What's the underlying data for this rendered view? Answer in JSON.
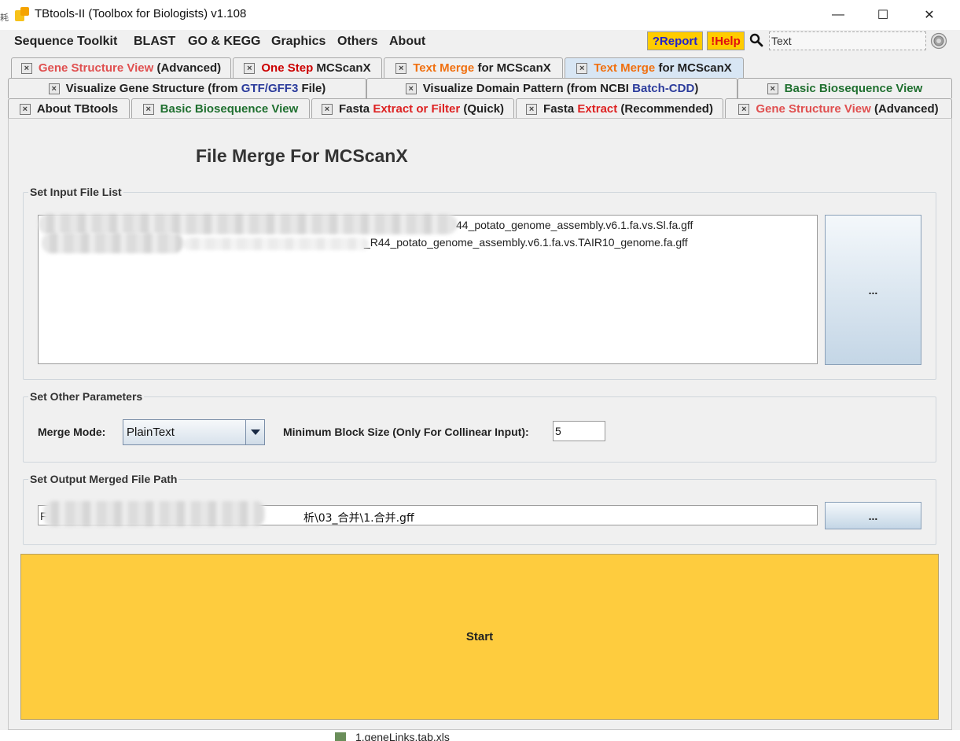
{
  "window": {
    "title": "TBtools-II (Toolbox for Biologists) v1.108",
    "minimize_glyph": "—",
    "maximize_glyph": "☐",
    "close_glyph": "✕",
    "edge_char": "耗"
  },
  "menu": {
    "items": [
      "Sequence Toolkit",
      "BLAST",
      "GO & KEGG",
      "Graphics",
      "Others",
      "About"
    ],
    "report_label": "?Report",
    "help_label": "!Help",
    "search_value": "Text"
  },
  "tabs": {
    "row1": [
      {
        "parts": [
          "Gene Structure View",
          " (Advanced)"
        ]
      },
      {
        "parts": [
          "One Step",
          " MCScanX"
        ]
      },
      {
        "parts": [
          "Text Merge",
          " for MCScanX"
        ]
      },
      {
        "parts": [
          "Text Merge",
          " for MCScanX"
        ],
        "active": true
      }
    ],
    "row2": [
      {
        "parts": [
          "Visualize Gene Structure (from ",
          "GTF/GFF3",
          " File)"
        ]
      },
      {
        "parts": [
          "Visualize Domain Pattern (from NCBI ",
          "Batch-CDD",
          ")"
        ]
      },
      {
        "parts": [
          "Basic Biosequence View"
        ]
      }
    ],
    "row3": [
      {
        "parts": [
          "About TBtools"
        ]
      },
      {
        "parts": [
          "Basic Biosequence View"
        ]
      },
      {
        "parts": [
          "Fasta ",
          "Extract or Filter",
          " (Quick)"
        ]
      },
      {
        "parts": [
          "Fasta ",
          "Extract",
          " (Recommended)"
        ]
      },
      {
        "parts": [
          "Gene Structure View",
          " (Advanced)"
        ]
      }
    ]
  },
  "panel": {
    "title": "File Merge For MCScanX",
    "input_group_label": "Set Input File List",
    "input_files": [
      "44_potato_genome_assembly.v6.1.fa.vs.Sl.fa.gff",
      "_R44_potato_genome_assembly.v6.1.fa.vs.TAIR10_genome.fa.gff"
    ],
    "input_file2_fragment": "...",
    "browse_input_label": "...",
    "params_group_label": "Set Other Parameters",
    "merge_mode_label": "Merge Mode:",
    "merge_mode_value": "PlainText",
    "min_block_label": "Minimum Block Size (Only For Collinear Input):",
    "min_block_value": "5",
    "output_group_label": "Set Output Merged File Path",
    "output_path_prefix": "F",
    "output_path_value": "析\\03_合并\\1.合并.gff",
    "browse_output_label": "...",
    "start_label": "Start"
  },
  "background": {
    "peek_text": "1.geneLinks.tab.xls"
  },
  "colors": {
    "start_button": "#fecc3e",
    "report_help_bg": "#ffcc00",
    "active_tab": "#d8e6f4"
  }
}
